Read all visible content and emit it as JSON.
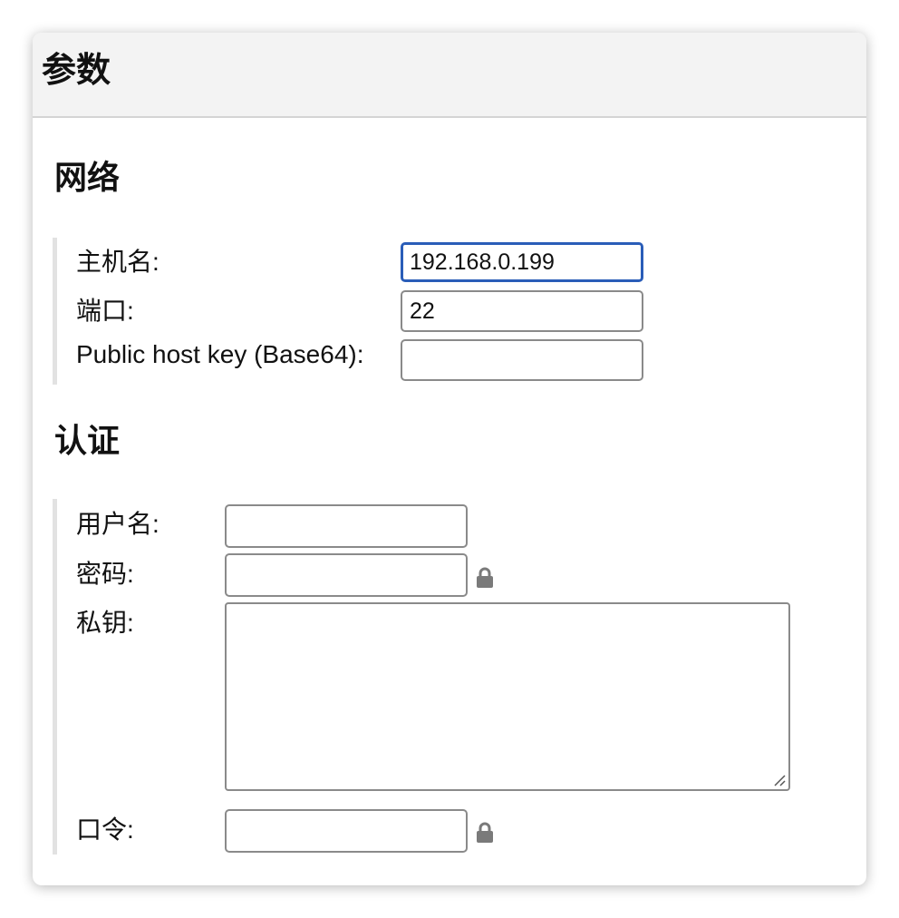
{
  "dialog": {
    "title": "参数"
  },
  "network": {
    "title": "网络",
    "hostname_label": "主机名:",
    "hostname_value": "192.168.0.199",
    "port_label": "端口:",
    "port_value": "22",
    "hostkey_label": "Public host key (Base64):",
    "hostkey_value": ""
  },
  "auth": {
    "title": "认证",
    "username_label": "用户名:",
    "username_value": "",
    "password_label": "密码:",
    "password_value": "",
    "privatekey_label": "私钥:",
    "privatekey_value": "",
    "passphrase_label": "口令:",
    "passphrase_value": ""
  },
  "icons": {
    "password_lock": "lock-icon",
    "passphrase_lock": "lock-icon",
    "textarea_resize": "resize-grip-icon"
  },
  "colors": {
    "focus_border": "#2a5db8",
    "header_bg": "#f3f3f3",
    "lock_icon": "#7a7a7a"
  }
}
